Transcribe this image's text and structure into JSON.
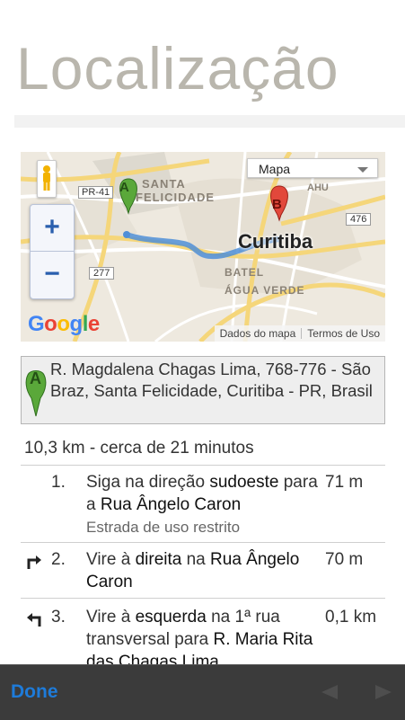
{
  "page": {
    "title": "Localização"
  },
  "map": {
    "type_selector": "Mapa",
    "zoom_in": "+",
    "zoom_out": "−",
    "footer_data": "Dados do mapa",
    "footer_terms": "Termos de Uso",
    "labels": {
      "santa": "SANTA",
      "felicidade": "FELICIDADE",
      "curitiba": "Curitiba",
      "batel": "BATEL",
      "agua_verde": "ÁGUA VERDE",
      "ahu": "AHU",
      "pr41": "PR-41",
      "r277": "277",
      "r476": "476"
    },
    "marker_a": "A",
    "marker_b": "B",
    "logo": "Google",
    "colors": {
      "route": "#4f8fd8",
      "marker_a": "#5aa83a",
      "marker_b": "#e2483b",
      "road_major": "#f5d67a"
    }
  },
  "address": {
    "marker": "A",
    "text": "R. Magdalena Chagas Lima, 768-776 - São Braz, Santa Felicidade, Curitiba - PR, Brasil"
  },
  "summary": "10,3 km - cerca de 21 minutos",
  "steps": [
    {
      "number": "1.",
      "text_a": "Siga na direção ",
      "bold_a": "sudoeste",
      "text_b": " para a ",
      "bold_b": "Rua Ângelo Caron",
      "note": "Estrada de uso restrito",
      "distance": "71 m",
      "icon": "none"
    },
    {
      "number": "2.",
      "text_a": "Vire à ",
      "bold_a": "direita",
      "text_b": " na ",
      "bold_b": "Rua Ângelo Caron",
      "note": "",
      "distance": "70 m",
      "icon": "turn-right-icon"
    },
    {
      "number": "3.",
      "text_a": "Vire à ",
      "bold_a": "esquerda",
      "text_b": " na 1ª rua transversal para ",
      "bold_b": "R. Maria Rita das Chagas Lima",
      "note": "",
      "distance": "0,1 km",
      "icon": "turn-left-icon"
    }
  ],
  "toolbar": {
    "done": "Done",
    "back_icon": "back-arrow-icon",
    "forward_icon": "forward-arrow-icon"
  }
}
